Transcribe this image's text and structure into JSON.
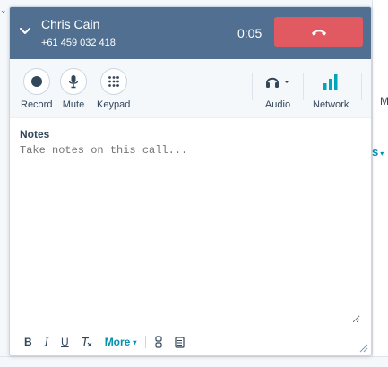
{
  "call": {
    "contact_name": "Chris Cain",
    "phone": "+61 459 032 418",
    "timer": "0:05"
  },
  "toolbar": {
    "record_label": "Record",
    "mute_label": "Mute",
    "keypad_label": "Keypad",
    "audio_label": "Audio",
    "network_label": "Network"
  },
  "notes": {
    "title": "Notes",
    "placeholder": "Take notes on this call..."
  },
  "format_bar": {
    "bold": "B",
    "italic": "I",
    "underline": "U",
    "clear": "Tx",
    "more_label": "More"
  },
  "background": {
    "right_edge_text": "M",
    "right_link_fragment": "s"
  },
  "colors": {
    "header": "#516f90",
    "hangup": "#e15a61",
    "accent": "#0091ae",
    "network_bars": "#00a4bd"
  },
  "icons": [
    "chevron-down-icon",
    "hangup-icon",
    "record-icon",
    "microphone-icon",
    "keypad-icon",
    "headset-icon",
    "network-bars-icon",
    "attachment-icon",
    "snippet-icon",
    "resize-icon"
  ]
}
